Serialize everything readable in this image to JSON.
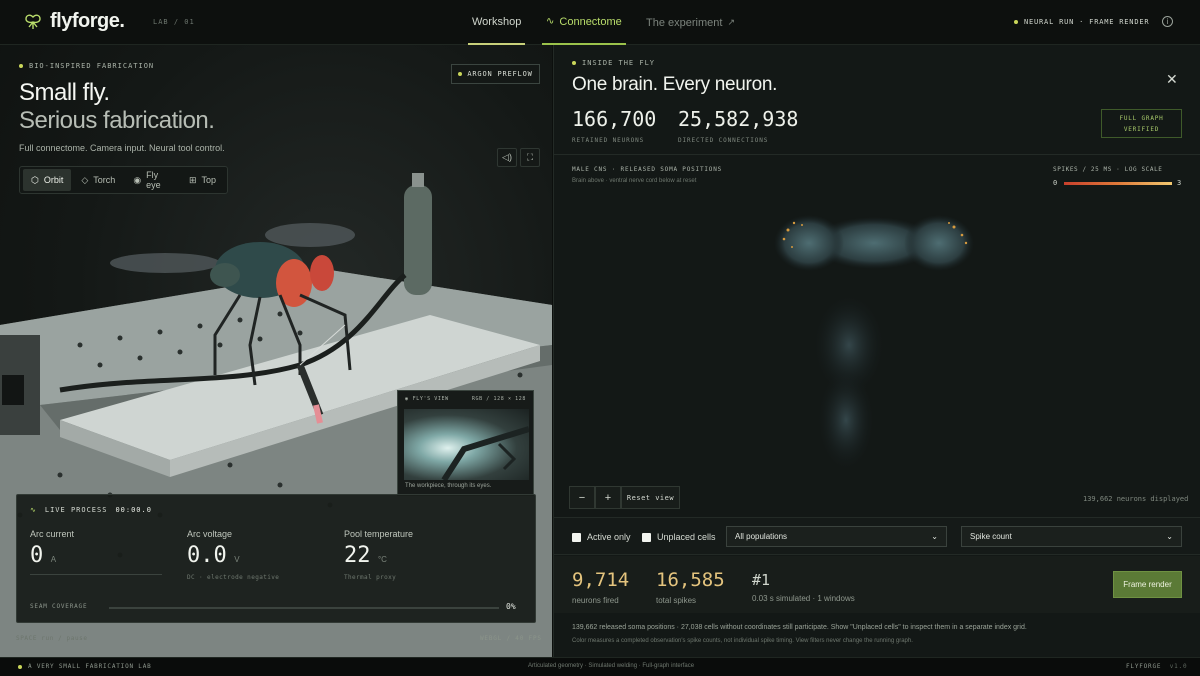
{
  "nav": {
    "logo": "flyforge.",
    "lab_tag": "LAB / 01",
    "tabs": [
      {
        "label": "Workshop"
      },
      {
        "label": "Connectome"
      },
      {
        "label": "The experiment"
      }
    ],
    "status": "NEURAL RUN · FRAME RENDER"
  },
  "scene": {
    "eyebrow": "BIO-INSPIRED FABRICATION",
    "hero_line1": "Small fly.",
    "hero_line2": "Serious fabrication.",
    "subtitle": "Full connectome. Camera input. Neural tool control.",
    "argon_label": "ARGON PREFLOW",
    "modes": [
      {
        "label": "Orbit"
      },
      {
        "label": "Torch"
      },
      {
        "label": "Fly eye"
      },
      {
        "label": "Top"
      }
    ],
    "fly_view": {
      "title": "FLY'S VIEW",
      "meta": "RGB / 128 × 128",
      "caption": "The workpiece, through its eyes."
    },
    "live": {
      "title": "LIVE PROCESS",
      "timer": "00:00.0",
      "arc_current_label": "Arc current",
      "arc_current_value": "0",
      "arc_current_unit": "A",
      "arc_voltage_label": "Arc voltage",
      "arc_voltage_value": "0.0",
      "arc_voltage_unit": "V",
      "arc_voltage_note": "DC · electrode negative",
      "pool_label": "Pool temperature",
      "pool_value": "22",
      "pool_unit": "°C",
      "pool_note": "Thermal proxy",
      "seam_label": "SEAM COVERAGE",
      "seam_value": "0%",
      "seam_fraction": 0
    },
    "footer_left": "SPACE  run / pause",
    "footer_right": "WEBGL / 40 FPS"
  },
  "panel": {
    "eyebrow": "INSIDE THE FLY",
    "title": "One brain. Every neuron.",
    "stats": [
      {
        "value": "166,700",
        "label": "RETAINED NEURONS"
      },
      {
        "value": "25,582,938",
        "label": "DIRECTED CONNECTIONS"
      }
    ],
    "verified_line1": "FULL GRAPH",
    "verified_line2": "VERIFIED",
    "viz_title": "MALE CNS · RELEASED SOMA POSITIONS",
    "viz_sub": "Brain above · ventral nerve cord below at reset",
    "spikes_label": "SPIKES / 25 MS · LOG SCALE",
    "spikes_min": "0",
    "spikes_max": "3",
    "zoom_out": "−",
    "zoom_in": "+",
    "reset_label": "Reset view",
    "displayed": "139,662 neurons displayed",
    "filters": {
      "active_only": "Active only",
      "unplaced": "Unplaced cells",
      "population": "All populations",
      "metric": "Spike count"
    },
    "results": {
      "fired_value": "9,714",
      "fired_label": "neurons fired",
      "spikes_value": "16,585",
      "spikes_label": "total spikes",
      "rank_value": "#1",
      "rank_label": "0.03 s simulated · 1 windows",
      "frame_button": "Frame render"
    },
    "note1": "139,662 released soma positions · 27,038 cells without coordinates still participate. Show \"Unplaced cells\" to inspect them in a separate index grid.",
    "note2": "Color measures a completed observation's spike counts, not individual spike timing. View filters never change the running graph."
  },
  "footer": {
    "left": "A VERY SMALL FABRICATION LAB",
    "center": "Articulated geometry · Simulated welding · Full-graph interface",
    "right_brand": "FLYFORGE",
    "right_version": "v1.0"
  },
  "colors": {
    "accent_green": "#9bc24b",
    "result_gold": "#e4c47e",
    "button_green": "#5b7a36"
  }
}
